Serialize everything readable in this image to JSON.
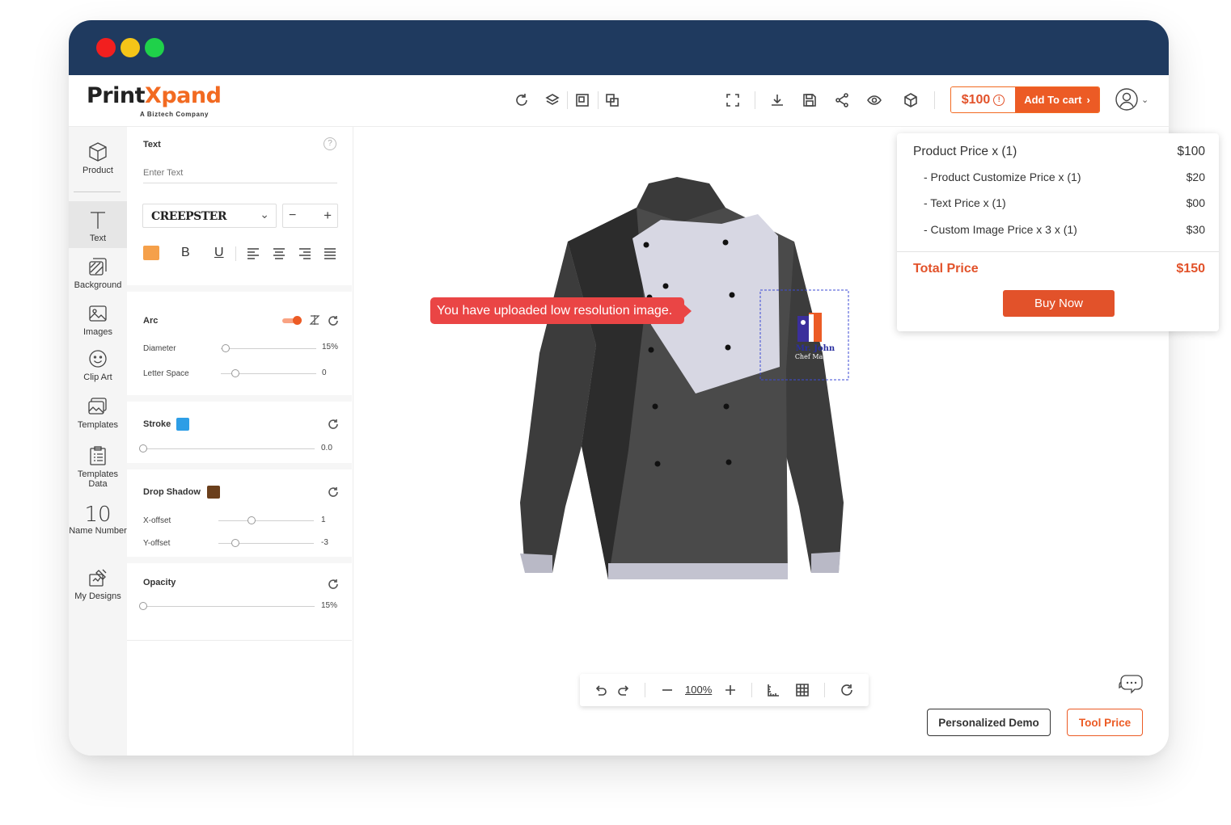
{
  "window": {
    "dots": [
      {
        "name": "close",
        "color": "#f21f1f"
      },
      {
        "name": "minimize",
        "color": "#f5c518"
      },
      {
        "name": "maximize",
        "color": "#1fd14a"
      }
    ]
  },
  "brand": {
    "name_part1": "Print",
    "name_part2": "Xpand",
    "tagline": "A Biztech Company",
    "accent": "#f26a21"
  },
  "toolbar": {
    "price": "$100",
    "add_to_cart": "Add To cart",
    "icons": [
      "reset-icon",
      "layers-icon",
      "group-icon",
      "ungroup-icon",
      "fullscreen-icon",
      "download-icon",
      "save-icon",
      "share-icon",
      "preview-icon",
      "3d-view-icon"
    ]
  },
  "sidebar": {
    "items": [
      {
        "label": "Product"
      },
      {
        "label": "Text"
      },
      {
        "label": "Background"
      },
      {
        "label": "Images"
      },
      {
        "label": "Clip Art"
      },
      {
        "label": "Templates"
      },
      {
        "label": "Templates Data"
      },
      {
        "label": "Name Number",
        "glyph": "10"
      },
      {
        "label": "My Designs"
      }
    ]
  },
  "text_panel": {
    "title": "Text",
    "input_placeholder": "Enter Text",
    "font": "CREEPSTER",
    "text_color": "#f5a04a",
    "format_buttons": [
      "B",
      "U"
    ],
    "arc": {
      "label": "Arc",
      "enabled": true,
      "diameter_label": "Diameter",
      "diameter_value": "15%",
      "diameter_level": 0.05,
      "letter_space_label": "Letter Space",
      "letter_space_value": "0",
      "letter_space_level": 0.15
    },
    "stroke": {
      "label": "Stroke",
      "color": "#2e9ee6",
      "value": "0.0",
      "level": 0
    },
    "drop_shadow": {
      "label": "Drop Shadow",
      "color": "#6b3f1c",
      "x_offset_label": "X-offset",
      "x_offset_value": "1",
      "x_offset_level": 0.35,
      "y_offset_label": "Y-offset",
      "y_offset_value": "-3",
      "y_offset_level": 0.18
    },
    "opacity": {
      "label": "Opacity",
      "value": "15%",
      "level": 0
    }
  },
  "canvas": {
    "warning": "You have uploaded low resolution image.",
    "design_text_line1": "Mr. John",
    "design_text_line2": "Chef Master",
    "zoom": "100%"
  },
  "price_popup": {
    "rows": [
      {
        "label": "Product Price  x  (1)",
        "value": "$100"
      },
      {
        "label": "- Product Customize Price  x  (1)",
        "value": "$20"
      },
      {
        "label": "- Text Price x (1)",
        "value": "$00"
      },
      {
        "label": "- Custom Image Price x 3 x  (1)",
        "value": "$30"
      }
    ],
    "total_label": "Total Price",
    "total_value": "$150",
    "buy_now": "Buy Now"
  },
  "footer": {
    "personalized_demo": "Personalized Demo",
    "tool_price": "Tool Price"
  }
}
